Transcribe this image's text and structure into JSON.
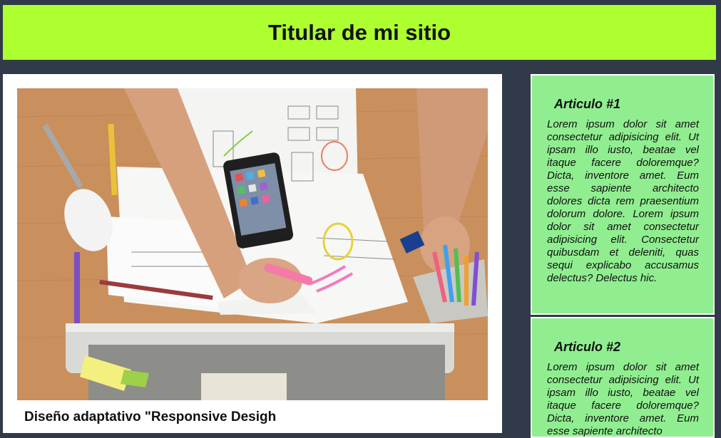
{
  "header": {
    "title": "Titular de mi sitio"
  },
  "main": {
    "image_alt": "Escritorio con computadora, smartphone, bocetos y marcadores",
    "caption": "Diseño adaptativo \"Responsive Desigh"
  },
  "articles": [
    {
      "title": "Articulo #1",
      "body": "Lorem ipsum dolor sit amet consectetur adipisicing elit. Ut ipsam illo iusto, beatae vel itaque facere doloremque? Dicta, inventore amet. Eum esse sapiente architecto dolores dicta rem praesentium dolorum dolore. Lorem ipsum dolor sit amet consectetur adipisicing elit. Consectetur quibusdam et deleniti, quas sequi explicabo accusamus delectus? Delectus hic."
    },
    {
      "title": "Articulo #2",
      "body": "Lorem ipsum dolor sit amet consectetur adipisicing elit. Ut ipsam illo iusto, beatae vel itaque facere doloremque? Dicta, inventore amet. Eum esse sapiente architecto"
    }
  ],
  "colors": {
    "background": "#313a48",
    "header": "#adff2f",
    "article": "#90ee90",
    "main": "#ffffff"
  }
}
